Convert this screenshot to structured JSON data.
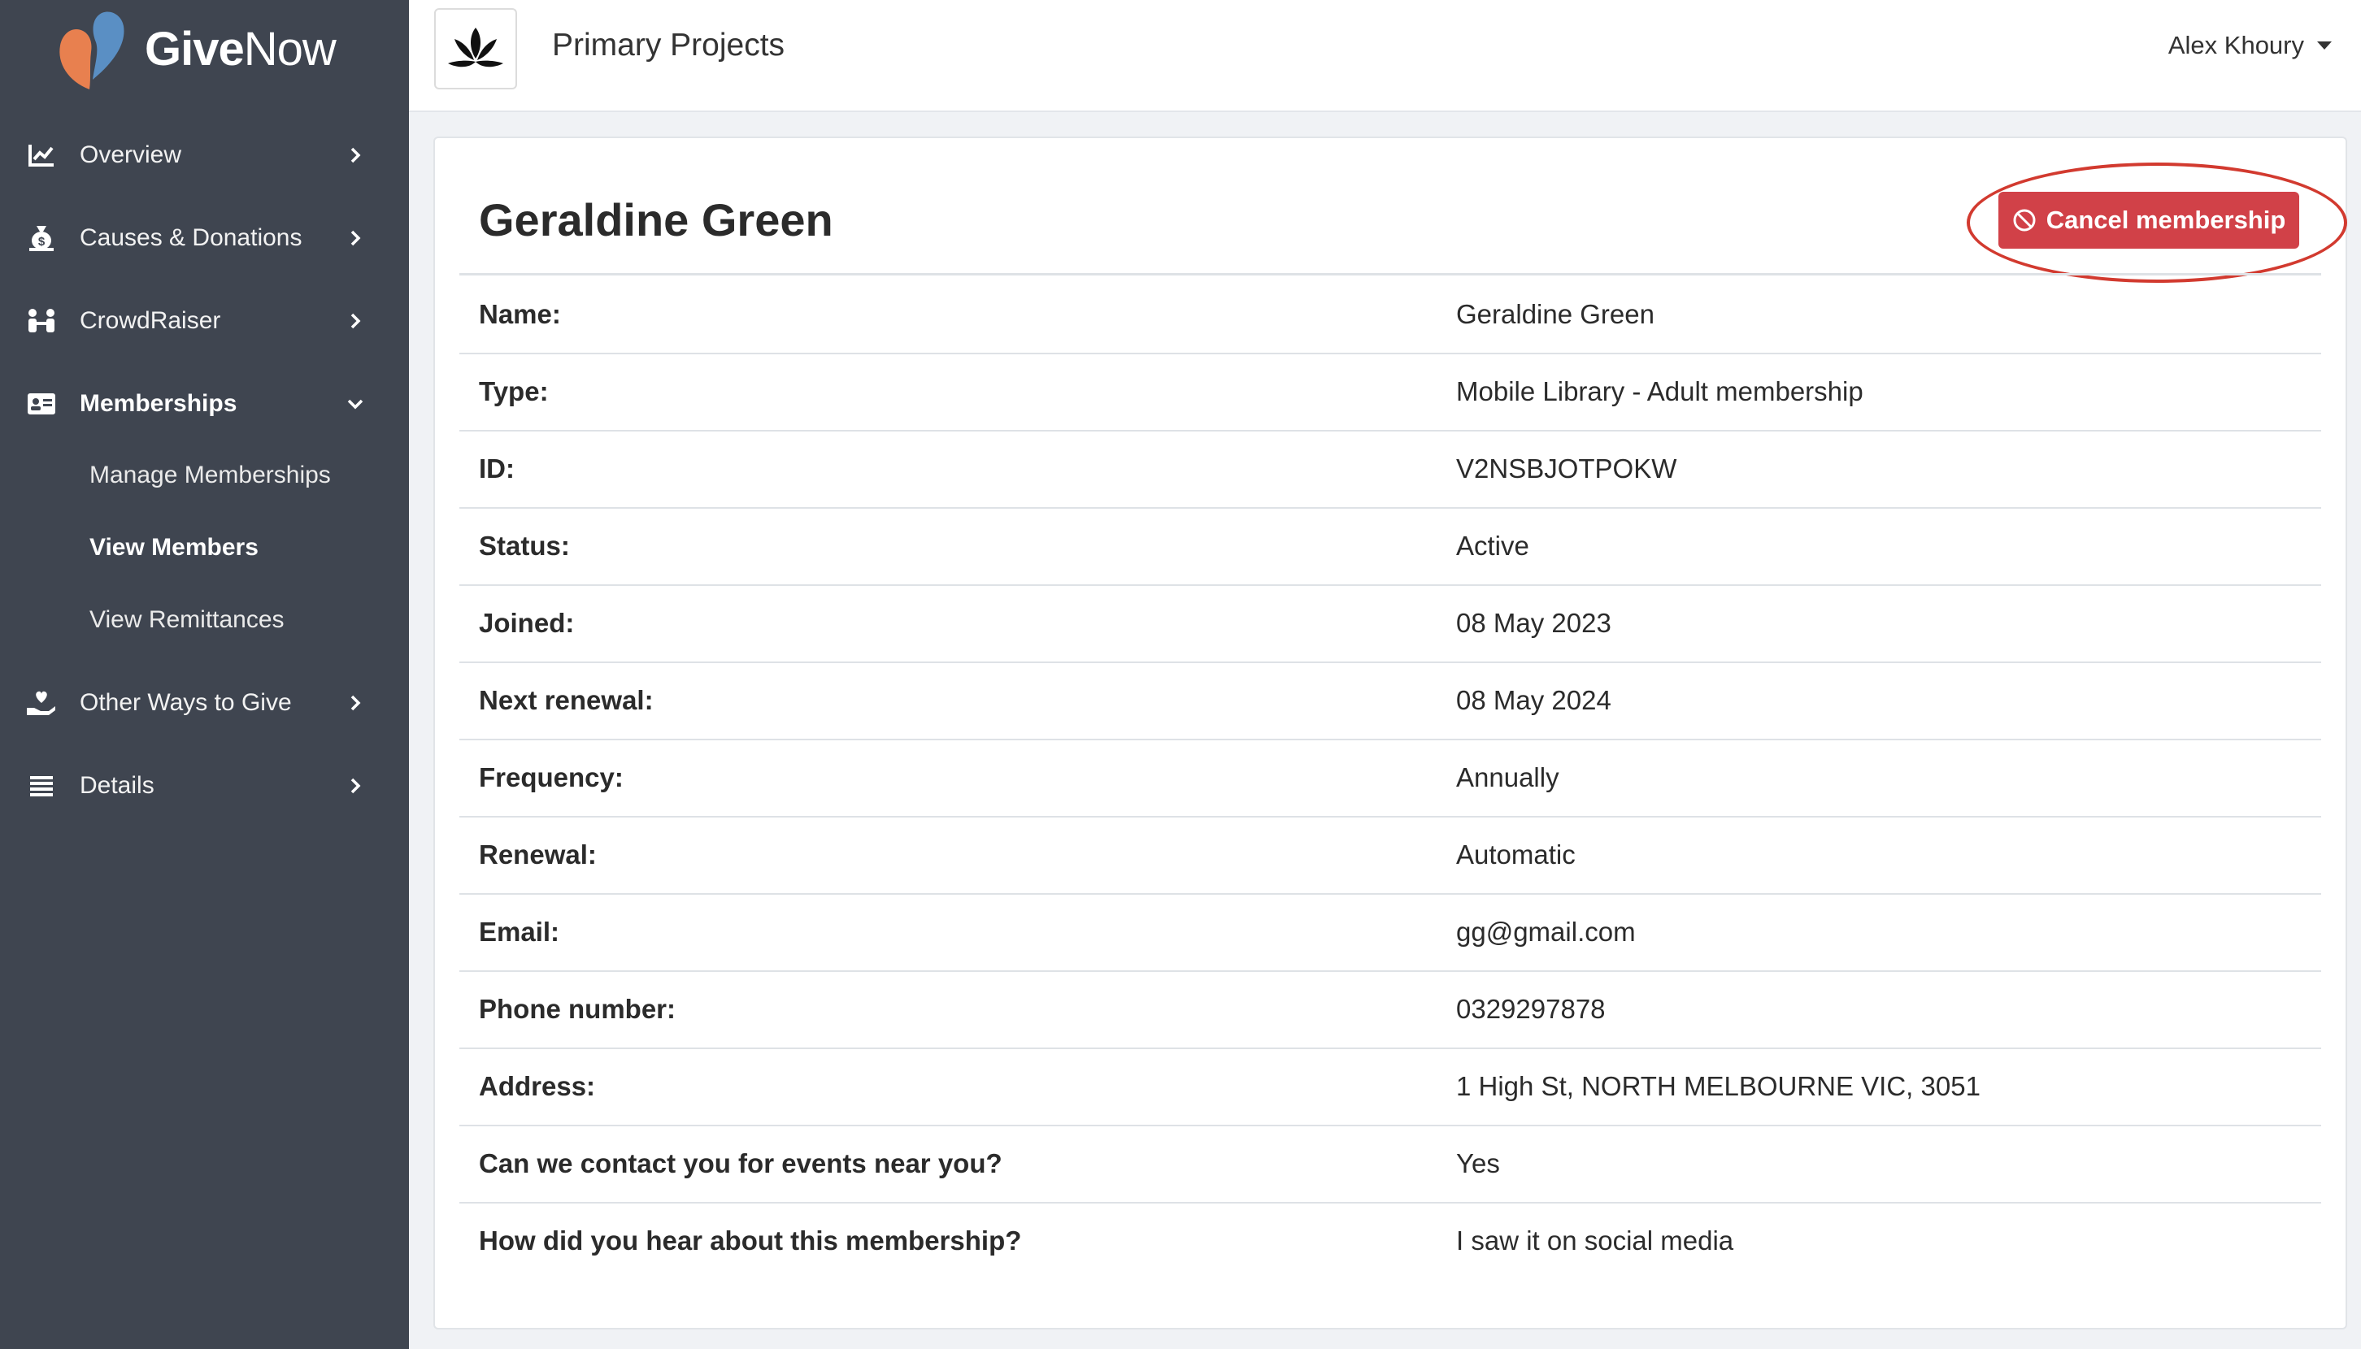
{
  "brand": {
    "logo_bold": "Give",
    "logo_light": "Now"
  },
  "sidebar": {
    "items": [
      {
        "label": "Overview",
        "icon": "chart-line-icon"
      },
      {
        "label": "Causes & Donations",
        "icon": "money-bag-icon"
      },
      {
        "label": "CrowdRaiser",
        "icon": "people-icon"
      },
      {
        "label": "Memberships",
        "icon": "id-card-icon",
        "expanded": true
      },
      {
        "label": "Other Ways to Give",
        "icon": "hand-heart-icon"
      },
      {
        "label": "Details",
        "icon": "list-icon"
      }
    ],
    "sub_items": [
      {
        "label": "Manage Memberships",
        "active": false
      },
      {
        "label": "View Members",
        "active": true
      },
      {
        "label": "View Remittances",
        "active": false
      }
    ]
  },
  "header": {
    "org_name": "Primary Projects",
    "user_name": "Alex Khoury"
  },
  "member": {
    "title": "Geraldine Green",
    "cancel_label": "Cancel membership",
    "rows": [
      {
        "label": "Name:",
        "value": "Geraldine Green"
      },
      {
        "label": "Type:",
        "value": "Mobile Library - Adult membership"
      },
      {
        "label": "ID:",
        "value": "V2NSBJOTPOKW"
      },
      {
        "label": "Status:",
        "value": "Active"
      },
      {
        "label": "Joined:",
        "value": "08 May 2023"
      },
      {
        "label": "Next renewal:",
        "value": "08 May 2024"
      },
      {
        "label": "Frequency:",
        "value": "Annually"
      },
      {
        "label": "Renewal:",
        "value": "Automatic"
      },
      {
        "label": "Email:",
        "value": "gg@gmail.com"
      },
      {
        "label": "Phone number:",
        "value": "0329297878"
      },
      {
        "label": "Address:",
        "value": "1 High St, NORTH MELBOURNE VIC, 3051"
      },
      {
        "label": "Can we contact you for events near you?",
        "value": "Yes"
      },
      {
        "label": "How did you hear about this membership?",
        "value": "I saw it on social media"
      }
    ]
  },
  "colors": {
    "sidebar_bg": "#3f4550",
    "danger": "#d14148",
    "annotation": "#d23a2f",
    "logo_orange": "#e8804f",
    "logo_blue": "#5a8fc4"
  }
}
